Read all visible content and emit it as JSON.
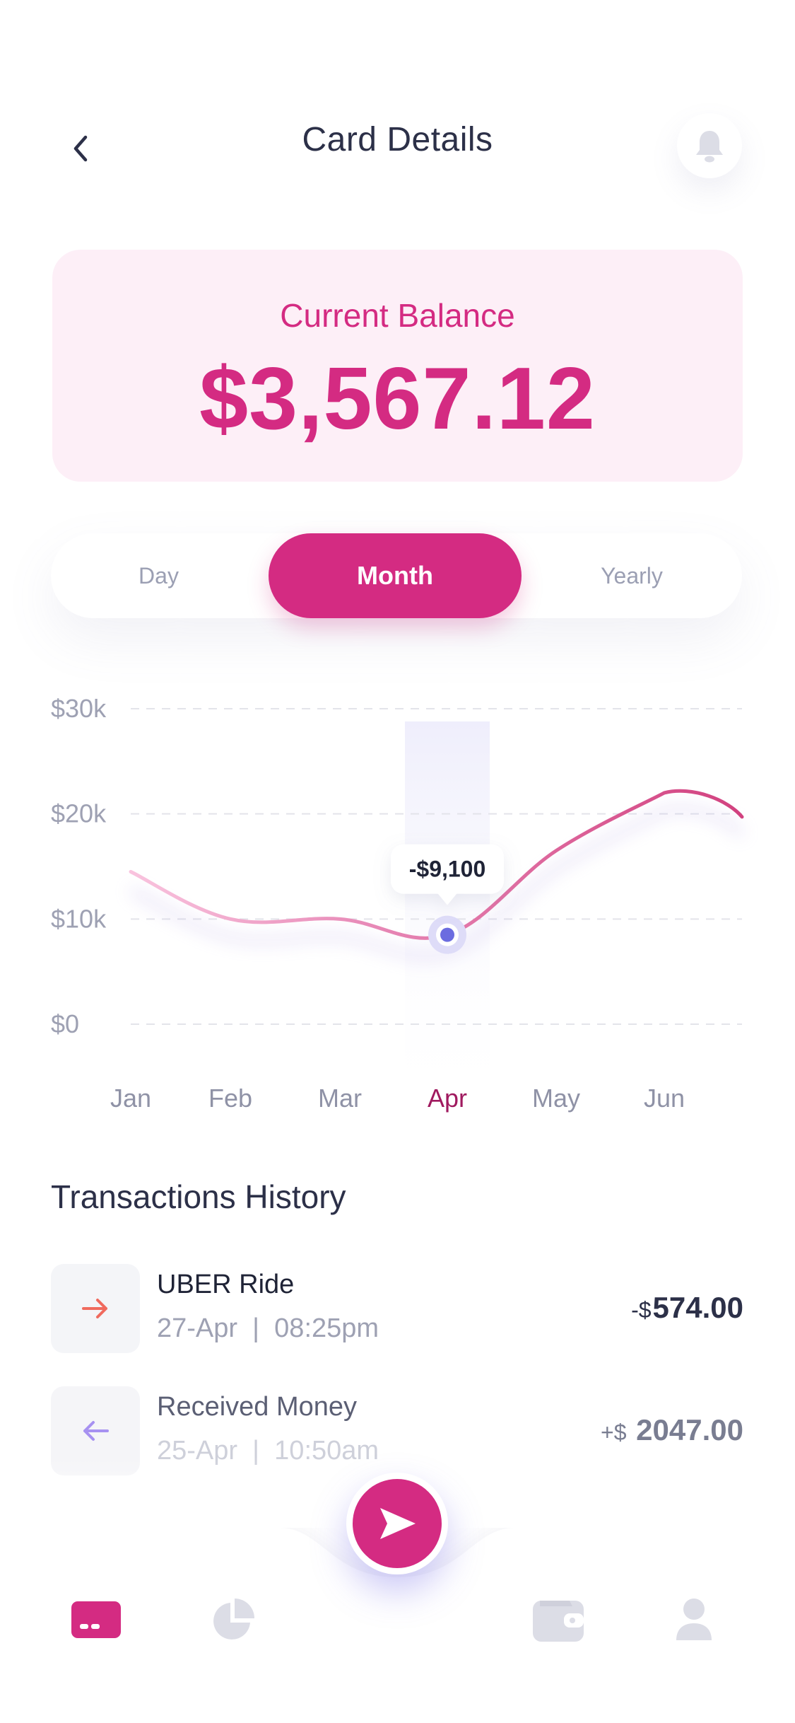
{
  "header": {
    "title": "Card Details",
    "back_icon": "chevron-left-icon",
    "notification_icon": "bell-icon"
  },
  "balance": {
    "label": "Current Balance",
    "value": "$3,567.12"
  },
  "period_toggle": {
    "options": [
      "Day",
      "Month",
      "Yearly"
    ],
    "selected": "Month"
  },
  "chart_data": {
    "type": "line",
    "categories": [
      "Jan",
      "Feb",
      "Mar",
      "Apr",
      "May",
      "Jun"
    ],
    "y_tick_labels": [
      "$30k",
      "$20k",
      "$10k",
      "$0"
    ],
    "ylim": [
      0,
      30000
    ],
    "series": [
      {
        "values": [
          14500,
          10000,
          10000,
          8500,
          16500,
          22000
        ]
      }
    ],
    "highlighted": {
      "category": "Apr",
      "label": "-$9,100"
    },
    "grid": true,
    "colors": {
      "line_start": "#f7b8d6",
      "line_end": "#d2417f",
      "highlight_point": "#6b6ce0",
      "active_label": "#a01a5f"
    }
  },
  "transactions": {
    "title": "Transactions History",
    "items": [
      {
        "name": "UBER Ride",
        "date": "27-Apr",
        "time": "08:25pm",
        "sign": "-$",
        "amount": "574.00",
        "icon": "arrow-right-icon"
      },
      {
        "name": "Received Money",
        "date": "25-Apr",
        "time": "10:50am",
        "sign": "+$",
        "amount": "2047.00",
        "icon": "arrow-left-icon"
      }
    ]
  },
  "bottom_nav": {
    "items": [
      "card-icon",
      "pie-chart-icon",
      "wallet-icon",
      "user-icon"
    ],
    "active": "card-icon",
    "center_action": "send-icon"
  },
  "colors": {
    "accent": "#d42b82",
    "accent_light": "#fdeff7",
    "text_dark": "#2c3048",
    "text_muted": "#9ea1b3"
  }
}
